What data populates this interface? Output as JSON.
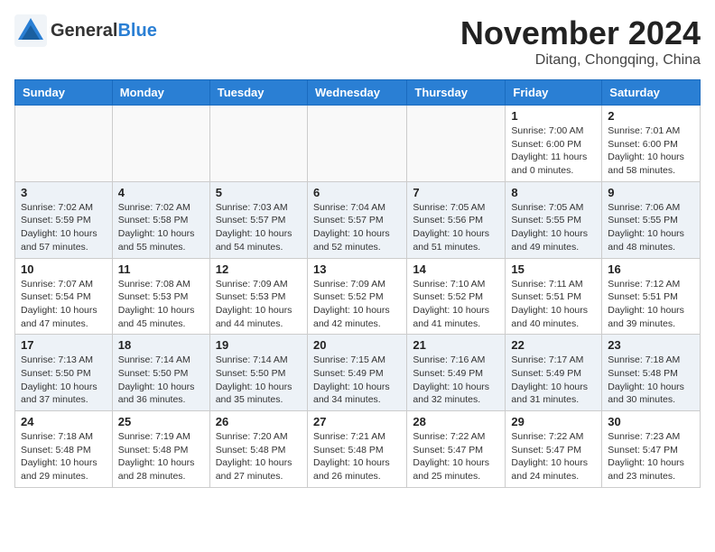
{
  "header": {
    "logo_general": "General",
    "logo_blue": "Blue",
    "month": "November 2024",
    "location": "Ditang, Chongqing, China"
  },
  "weekdays": [
    "Sunday",
    "Monday",
    "Tuesday",
    "Wednesday",
    "Thursday",
    "Friday",
    "Saturday"
  ],
  "weeks": [
    [
      {
        "day": "",
        "info": ""
      },
      {
        "day": "",
        "info": ""
      },
      {
        "day": "",
        "info": ""
      },
      {
        "day": "",
        "info": ""
      },
      {
        "day": "",
        "info": ""
      },
      {
        "day": "1",
        "info": "Sunrise: 7:00 AM\nSunset: 6:00 PM\nDaylight: 11 hours\nand 0 minutes."
      },
      {
        "day": "2",
        "info": "Sunrise: 7:01 AM\nSunset: 6:00 PM\nDaylight: 10 hours\nand 58 minutes."
      }
    ],
    [
      {
        "day": "3",
        "info": "Sunrise: 7:02 AM\nSunset: 5:59 PM\nDaylight: 10 hours\nand 57 minutes."
      },
      {
        "day": "4",
        "info": "Sunrise: 7:02 AM\nSunset: 5:58 PM\nDaylight: 10 hours\nand 55 minutes."
      },
      {
        "day": "5",
        "info": "Sunrise: 7:03 AM\nSunset: 5:57 PM\nDaylight: 10 hours\nand 54 minutes."
      },
      {
        "day": "6",
        "info": "Sunrise: 7:04 AM\nSunset: 5:57 PM\nDaylight: 10 hours\nand 52 minutes."
      },
      {
        "day": "7",
        "info": "Sunrise: 7:05 AM\nSunset: 5:56 PM\nDaylight: 10 hours\nand 51 minutes."
      },
      {
        "day": "8",
        "info": "Sunrise: 7:05 AM\nSunset: 5:55 PM\nDaylight: 10 hours\nand 49 minutes."
      },
      {
        "day": "9",
        "info": "Sunrise: 7:06 AM\nSunset: 5:55 PM\nDaylight: 10 hours\nand 48 minutes."
      }
    ],
    [
      {
        "day": "10",
        "info": "Sunrise: 7:07 AM\nSunset: 5:54 PM\nDaylight: 10 hours\nand 47 minutes."
      },
      {
        "day": "11",
        "info": "Sunrise: 7:08 AM\nSunset: 5:53 PM\nDaylight: 10 hours\nand 45 minutes."
      },
      {
        "day": "12",
        "info": "Sunrise: 7:09 AM\nSunset: 5:53 PM\nDaylight: 10 hours\nand 44 minutes."
      },
      {
        "day": "13",
        "info": "Sunrise: 7:09 AM\nSunset: 5:52 PM\nDaylight: 10 hours\nand 42 minutes."
      },
      {
        "day": "14",
        "info": "Sunrise: 7:10 AM\nSunset: 5:52 PM\nDaylight: 10 hours\nand 41 minutes."
      },
      {
        "day": "15",
        "info": "Sunrise: 7:11 AM\nSunset: 5:51 PM\nDaylight: 10 hours\nand 40 minutes."
      },
      {
        "day": "16",
        "info": "Sunrise: 7:12 AM\nSunset: 5:51 PM\nDaylight: 10 hours\nand 39 minutes."
      }
    ],
    [
      {
        "day": "17",
        "info": "Sunrise: 7:13 AM\nSunset: 5:50 PM\nDaylight: 10 hours\nand 37 minutes."
      },
      {
        "day": "18",
        "info": "Sunrise: 7:14 AM\nSunset: 5:50 PM\nDaylight: 10 hours\nand 36 minutes."
      },
      {
        "day": "19",
        "info": "Sunrise: 7:14 AM\nSunset: 5:50 PM\nDaylight: 10 hours\nand 35 minutes."
      },
      {
        "day": "20",
        "info": "Sunrise: 7:15 AM\nSunset: 5:49 PM\nDaylight: 10 hours\nand 34 minutes."
      },
      {
        "day": "21",
        "info": "Sunrise: 7:16 AM\nSunset: 5:49 PM\nDaylight: 10 hours\nand 32 minutes."
      },
      {
        "day": "22",
        "info": "Sunrise: 7:17 AM\nSunset: 5:49 PM\nDaylight: 10 hours\nand 31 minutes."
      },
      {
        "day": "23",
        "info": "Sunrise: 7:18 AM\nSunset: 5:48 PM\nDaylight: 10 hours\nand 30 minutes."
      }
    ],
    [
      {
        "day": "24",
        "info": "Sunrise: 7:18 AM\nSunset: 5:48 PM\nDaylight: 10 hours\nand 29 minutes."
      },
      {
        "day": "25",
        "info": "Sunrise: 7:19 AM\nSunset: 5:48 PM\nDaylight: 10 hours\nand 28 minutes."
      },
      {
        "day": "26",
        "info": "Sunrise: 7:20 AM\nSunset: 5:48 PM\nDaylight: 10 hours\nand 27 minutes."
      },
      {
        "day": "27",
        "info": "Sunrise: 7:21 AM\nSunset: 5:48 PM\nDaylight: 10 hours\nand 26 minutes."
      },
      {
        "day": "28",
        "info": "Sunrise: 7:22 AM\nSunset: 5:47 PM\nDaylight: 10 hours\nand 25 minutes."
      },
      {
        "day": "29",
        "info": "Sunrise: 7:22 AM\nSunset: 5:47 PM\nDaylight: 10 hours\nand 24 minutes."
      },
      {
        "day": "30",
        "info": "Sunrise: 7:23 AM\nSunset: 5:47 PM\nDaylight: 10 hours\nand 23 minutes."
      }
    ]
  ]
}
